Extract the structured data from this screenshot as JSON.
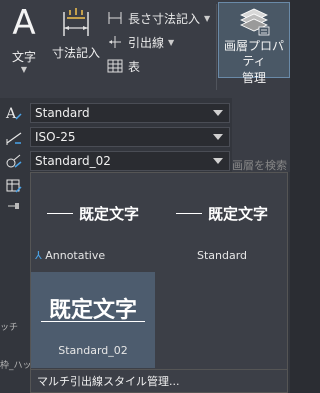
{
  "ribbon": {
    "text_button": {
      "glyph": "A",
      "label": "文字"
    },
    "dim_button": {
      "label": "寸法記入"
    },
    "small_buttons": [
      {
        "label": "長さ寸法記入",
        "icon": "linear-dimension-icon",
        "has_dropdown": true
      },
      {
        "label": "引出線",
        "icon": "leader-icon",
        "has_dropdown": true
      },
      {
        "label": "表",
        "icon": "table-icon",
        "has_dropdown": false
      }
    ],
    "layer_button": {
      "label_line1": "画層プロパティ",
      "label_line2": "管理"
    }
  },
  "style_combos": [
    {
      "value": "Standard",
      "icon": "text-style-icon"
    },
    {
      "value": "ISO-25",
      "icon": "dimension-style-icon"
    },
    {
      "value": "Standard_02",
      "icon": "multileader-style-icon"
    }
  ],
  "layer_search_placeholder": "画層を検索",
  "side_fragments": [
    "ッチ",
    "枠_ハッ"
  ],
  "dropdown": {
    "items": [
      {
        "name": "Annotative",
        "sample": "既定文字",
        "annotative": true,
        "selected": false
      },
      {
        "name": "Standard",
        "sample": "既定文字",
        "annotative": false,
        "selected": false
      },
      {
        "name": "Standard_02",
        "sample": "既定文字",
        "annotative": false,
        "selected": true
      }
    ],
    "manage_label": "マルチ引出線スタイル管理..."
  },
  "colors": {
    "ribbon_bg": "#3a3d45",
    "popup_bg": "#3c3f47",
    "selected_bg": "#4d5c6e",
    "accent_blue": "#4aa3e8"
  }
}
